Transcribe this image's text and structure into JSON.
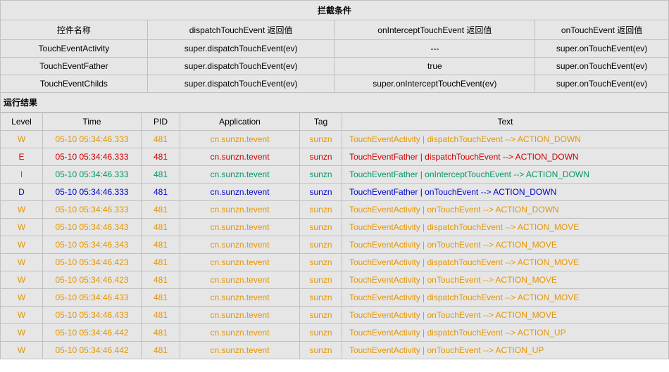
{
  "top": {
    "title": "拦截条件",
    "headers": [
      "控件名称",
      "dispatchTouchEvent 返回值",
      "onInterceptTouchEvent 返回值",
      "onTouchEvent 返回值"
    ],
    "rows": [
      [
        "TouchEventActivity",
        "super.dispatchTouchEvent(ev)",
        "---",
        "super.onTouchEvent(ev)"
      ],
      [
        "TouchEventFather",
        "super.dispatchTouchEvent(ev)",
        "true",
        "super.onTouchEvent(ev)"
      ],
      [
        "TouchEventChilds",
        "super.dispatchTouchEvent(ev)",
        "super.onInterceptTouchEvent(ev)",
        "super.onTouchEvent(ev)"
      ]
    ]
  },
  "result_title": "运行结果",
  "log": {
    "headers": [
      "Level",
      "Time",
      "PID",
      "Application",
      "Tag",
      "Text"
    ],
    "rows": [
      {
        "lvl": "W",
        "time": "05-10 05:34:46.333",
        "pid": "481",
        "app": "cn.sunzn.tevent",
        "tag": "sunzn",
        "text": "TouchEventActivity | dispatchTouchEvent --> ACTION_DOWN"
      },
      {
        "lvl": "E",
        "time": "05-10 05:34:46.333",
        "pid": "481",
        "app": "cn.sunzn.tevent",
        "tag": "sunzn",
        "text": "TouchEventFather | dispatchTouchEvent --> ACTION_DOWN"
      },
      {
        "lvl": "I",
        "time": "05-10 05:34:46.333",
        "pid": "481",
        "app": "cn.sunzn.tevent",
        "tag": "sunzn",
        "text": "TouchEventFather | onInterceptTouchEvent --> ACTION_DOWN"
      },
      {
        "lvl": "D",
        "time": "05-10 05:34:46.333",
        "pid": "481",
        "app": "cn.sunzn.tevent",
        "tag": "sunzn",
        "text": "TouchEventFather | onTouchEvent --> ACTION_DOWN"
      },
      {
        "lvl": "W",
        "time": "05-10 05:34:46.333",
        "pid": "481",
        "app": "cn.sunzn.tevent",
        "tag": "sunzn",
        "text": "TouchEventActivity | onTouchEvent --> ACTION_DOWN"
      },
      {
        "lvl": "W",
        "time": "05-10 05:34:46.343",
        "pid": "481",
        "app": "cn.sunzn.tevent",
        "tag": "sunzn",
        "text": "TouchEventActivity | dispatchTouchEvent --> ACTION_MOVE"
      },
      {
        "lvl": "W",
        "time": "05-10 05:34:46.343",
        "pid": "481",
        "app": "cn.sunzn.tevent",
        "tag": "sunzn",
        "text": "TouchEventActivity | onTouchEvent --> ACTION_MOVE"
      },
      {
        "lvl": "W",
        "time": "05-10 05:34:46.423",
        "pid": "481",
        "app": "cn.sunzn.tevent",
        "tag": "sunzn",
        "text": "TouchEventActivity | dispatchTouchEvent --> ACTION_MOVE"
      },
      {
        "lvl": "W",
        "time": "05-10 05:34:46.423",
        "pid": "481",
        "app": "cn.sunzn.tevent",
        "tag": "sunzn",
        "text": "TouchEventActivity | onTouchEvent --> ACTION_MOVE"
      },
      {
        "lvl": "W",
        "time": "05-10 05:34:46.433",
        "pid": "481",
        "app": "cn.sunzn.tevent",
        "tag": "sunzn",
        "text": "TouchEventActivity | dispatchTouchEvent --> ACTION_MOVE"
      },
      {
        "lvl": "W",
        "time": "05-10 05:34:46.433",
        "pid": "481",
        "app": "cn.sunzn.tevent",
        "tag": "sunzn",
        "text": "TouchEventActivity | onTouchEvent --> ACTION_MOVE"
      },
      {
        "lvl": "W",
        "time": "05-10 05:34:46.442",
        "pid": "481",
        "app": "cn.sunzn.tevent",
        "tag": "sunzn",
        "text": "TouchEventActivity | dispatchTouchEvent --> ACTION_UP"
      },
      {
        "lvl": "W",
        "time": "05-10 05:34:46.442",
        "pid": "481",
        "app": "cn.sunzn.tevent",
        "tag": "sunzn",
        "text": "TouchEventActivity | onTouchEvent --> ACTION_UP"
      }
    ]
  }
}
